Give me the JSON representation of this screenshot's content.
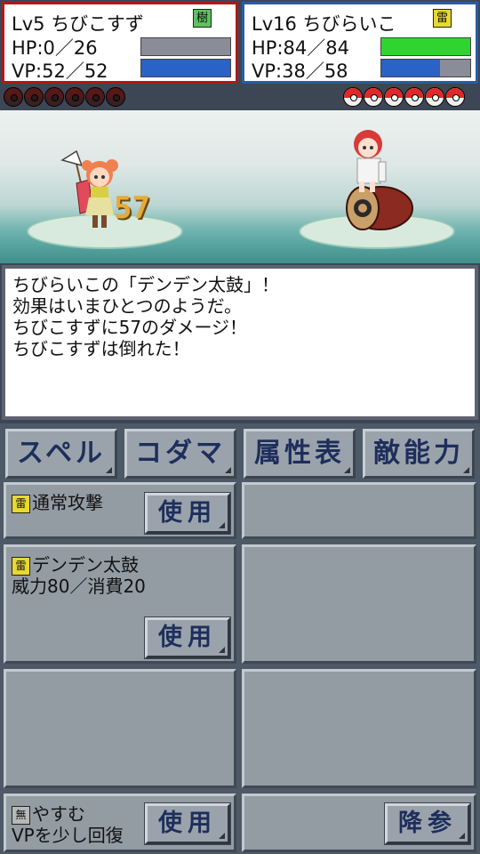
{
  "player": {
    "level": "Lv5",
    "name": "ちびこすず",
    "element": "樹",
    "hp_text": "HP:0／26",
    "vp_text": "VP:52／52",
    "hp_fraction": 0.0,
    "vp_fraction": 1.0,
    "hp_color": "#2fd42f",
    "vp_color": "#2a62c8",
    "balls": [
      "dark",
      "dark",
      "dark",
      "dark",
      "dark",
      "dark"
    ]
  },
  "enemy": {
    "level": "Lv16",
    "name": "ちびらいこ",
    "element": "雷",
    "hp_text": "HP:84／84",
    "vp_text": "VP:38／58",
    "hp_fraction": 1.0,
    "vp_fraction": 0.655,
    "hp_color": "#2fd42f",
    "vp_color": "#2a62c8",
    "balls": [
      "red",
      "red",
      "red",
      "red",
      "red",
      "red"
    ]
  },
  "battle": {
    "damage": "57"
  },
  "message": {
    "lines": [
      "ちびらいこの「デンデン太鼓」！",
      "効果はいまひとつのようだ。",
      "ちびこすずに57のダメージ！",
      "ちびこすずは倒れた！"
    ]
  },
  "tabs": [
    "スペル",
    "コダマ",
    "属性表",
    "敵能力"
  ],
  "moves": [
    {
      "element": "雷",
      "name": "通常攻撃",
      "detail": "",
      "button": "使用"
    },
    {
      "element": "雷",
      "name": "デンデン太鼓",
      "detail": "威力80／消費20",
      "button": "使用"
    }
  ],
  "rest": {
    "element": "無",
    "name": "やすむ",
    "detail": "VPを少し回復",
    "button": "使用"
  },
  "surrender": {
    "button": "降参"
  },
  "colors": {
    "player_frame": "#b01818",
    "enemy_frame": "#2b5ba8",
    "element_tree": "#5cc45c",
    "element_thunder": "#e8d832",
    "element_none": "#b8b8b8"
  }
}
